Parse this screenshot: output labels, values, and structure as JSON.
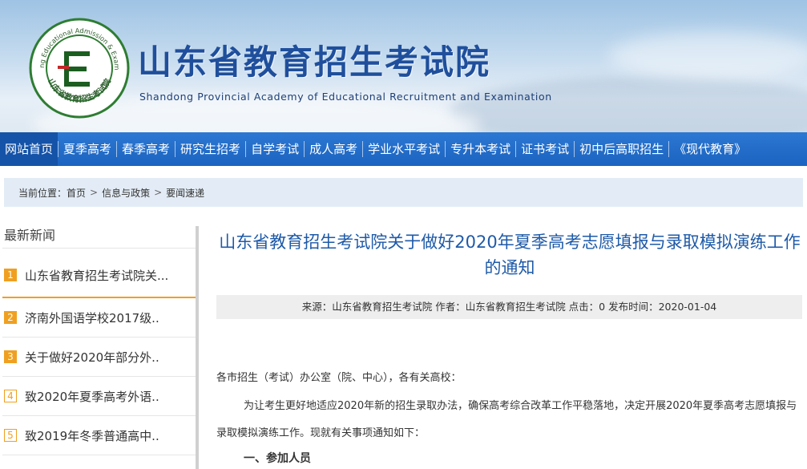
{
  "header": {
    "title": "山东省教育招生考试院",
    "subtitle": "Shandong Provincial Academy of Educational Recruitment and Examination",
    "logo": {
      "ring_text_en": "Shandong Educational Admission & Examination",
      "ring_text_cn": "山东省教育招生考试院",
      "letter": "E",
      "colors": {
        "ring": "#2e7d32",
        "letter": "#1b5e20",
        "accent": "#c62828"
      }
    }
  },
  "nav": {
    "items": [
      {
        "label": "网站首页",
        "active": true
      },
      {
        "label": "夏季高考"
      },
      {
        "label": "春季高考"
      },
      {
        "label": "研究生招考"
      },
      {
        "label": "自学考试"
      },
      {
        "label": "成人高考"
      },
      {
        "label": "学业水平考试"
      },
      {
        "label": "专升本考试"
      },
      {
        "label": "证书考试"
      },
      {
        "label": "初中后高职招生"
      },
      {
        "label": "《现代教育》"
      }
    ]
  },
  "breadcrumb": {
    "prefix": "当前位置：",
    "items": [
      "首页",
      "信息与政策",
      "要闻速递"
    ],
    "separator": ">"
  },
  "sidebar": {
    "title": "最新新闻",
    "items": [
      {
        "num": "1",
        "label": "山东省教育招生考试院关..."
      },
      {
        "num": "2",
        "label": "济南外国语学校2017级.."
      },
      {
        "num": "3",
        "label": "关于做好2020年部分外.."
      },
      {
        "num": "4",
        "label": "致2020年夏季高考外语.."
      },
      {
        "num": "5",
        "label": "致2019年冬季普通高中.."
      }
    ]
  },
  "article": {
    "title": "山东省教育招生考试院关于做好2020年夏季高考志愿填报与录取模拟演练工作的通知",
    "meta": "来源：山东省教育招生考试院 作者：山东省教育招生考试院 点击：0 发布时间：2020-01-04",
    "greeting": "各市招生（考试）办公室（院、中心），各有关高校：",
    "body": "为让考生更好地适应2020年新的招生录取办法，确保高考综合改革工作平稳落地，决定开展2020年夏季高考志愿填报与录取模拟演练工作。现就有关事项通知如下：",
    "section1": "一、参加人员"
  },
  "colors": {
    "nav_bg": "#1b63c0",
    "nav_active": "#1553a8",
    "title_blue": "#1e5aa8",
    "accent_orange": "#f0a020",
    "breadcrumb_bg": "#e3ecf6"
  }
}
